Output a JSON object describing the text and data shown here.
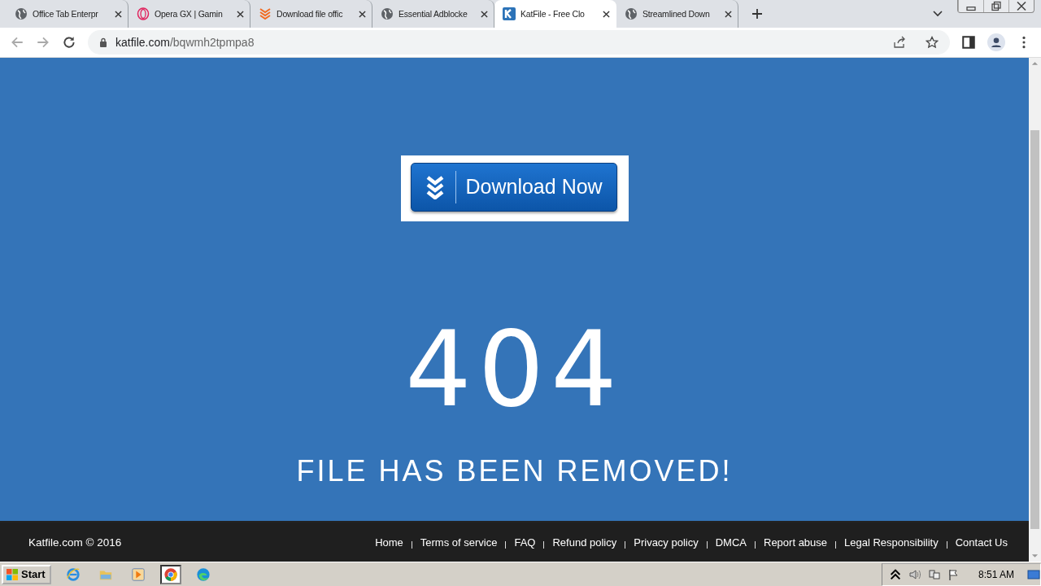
{
  "tabs": [
    {
      "title": "Office Tab Enterpr",
      "kind": "globe",
      "selected": false
    },
    {
      "title": "Opera GX | Gamin",
      "kind": "ring",
      "selected": false
    },
    {
      "title": "Download file offic",
      "kind": "chevrons",
      "selected": false
    },
    {
      "title": "Essential Adblocke",
      "kind": "globe",
      "selected": false
    },
    {
      "title": "KatFile - Free Clo",
      "kind": "logo",
      "selected": true
    },
    {
      "title": "Streamlined Down",
      "kind": "globe",
      "selected": false
    }
  ],
  "address": {
    "domain": "katfile.com",
    "path": "/bqwmh2tpmpa8"
  },
  "page": {
    "download_button": "Download Now",
    "code": "404",
    "message": "FILE HAS BEEN REMOVED!"
  },
  "footer": {
    "copyright": "Katfile.com © 2016",
    "links": [
      "Home",
      "Terms of service",
      "FAQ",
      "Refund policy",
      "Privacy policy",
      "DMCA",
      "Report abuse",
      "Legal Responsibility",
      "Contact Us"
    ]
  },
  "taskbar": {
    "start": "Start",
    "apps": [
      {
        "kind": "browser-e",
        "selected": false
      },
      {
        "kind": "folder",
        "selected": false
      },
      {
        "kind": "player",
        "selected": false
      },
      {
        "kind": "browser-c",
        "selected": true
      },
      {
        "kind": "browser-wave",
        "selected": false
      }
    ],
    "clock": "8:51 AM"
  }
}
